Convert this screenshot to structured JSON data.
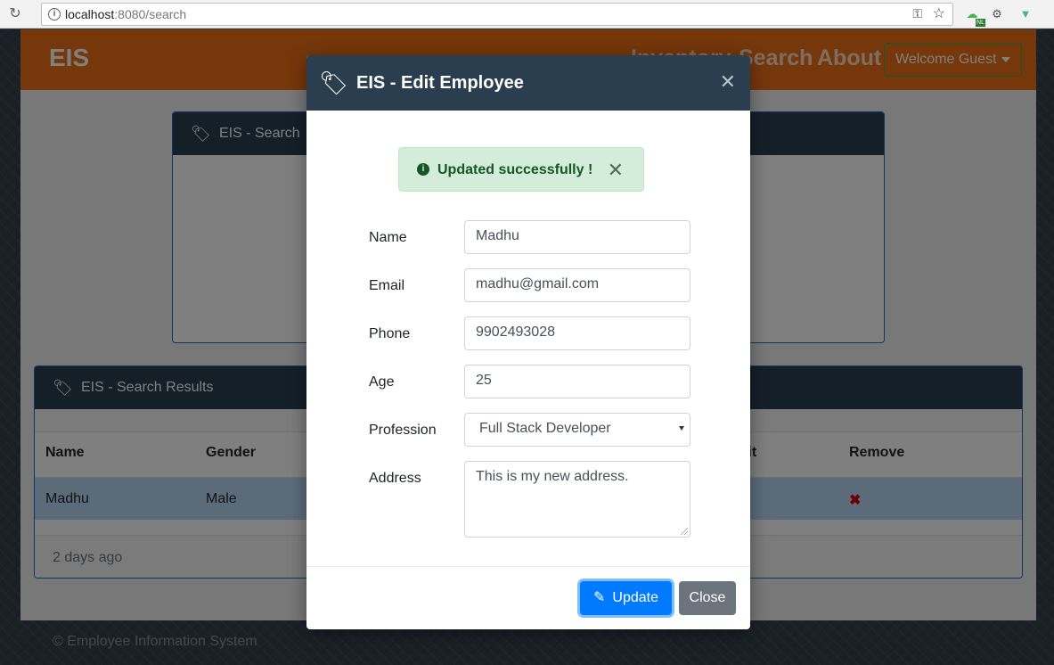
{
  "browser": {
    "url_host": "localhost",
    "url_path": ":8080/search",
    "ext_badge": "NL"
  },
  "app": {
    "brand": "EIS",
    "nav": [
      "Inventory",
      "Search",
      "About"
    ],
    "welcome": "Welcome Guest",
    "search_card_title": "EIS - Search",
    "results_card_title": "EIS - Search Results",
    "table": {
      "headers": [
        "Name",
        "Gender",
        "Edit",
        "Remove"
      ],
      "rows": [
        {
          "name": "Madhu",
          "gender": "Male",
          "remove": "✖"
        }
      ]
    },
    "results_footer": "2 days ago",
    "footer": "© Employee Information System"
  },
  "modal": {
    "title": "EIS - Edit Employee",
    "alert": "Updated successfully !",
    "fields": {
      "name": {
        "label": "Name",
        "value": "Madhu"
      },
      "email": {
        "label": "Email",
        "value": "madhu@gmail.com"
      },
      "phone": {
        "label": "Phone",
        "value": "9902493028"
      },
      "age": {
        "label": "Age",
        "value": "25"
      },
      "profession": {
        "label": "Profession",
        "value": "Full Stack Developer"
      },
      "address": {
        "label": "Address",
        "value": "This is my new address."
      }
    },
    "update_label": "Update",
    "close_label": "Close"
  },
  "colors": {
    "navbar": "#ec6f14",
    "card_header": "#2b3e50",
    "primary": "#007bff",
    "success_bg": "#d4edda"
  }
}
